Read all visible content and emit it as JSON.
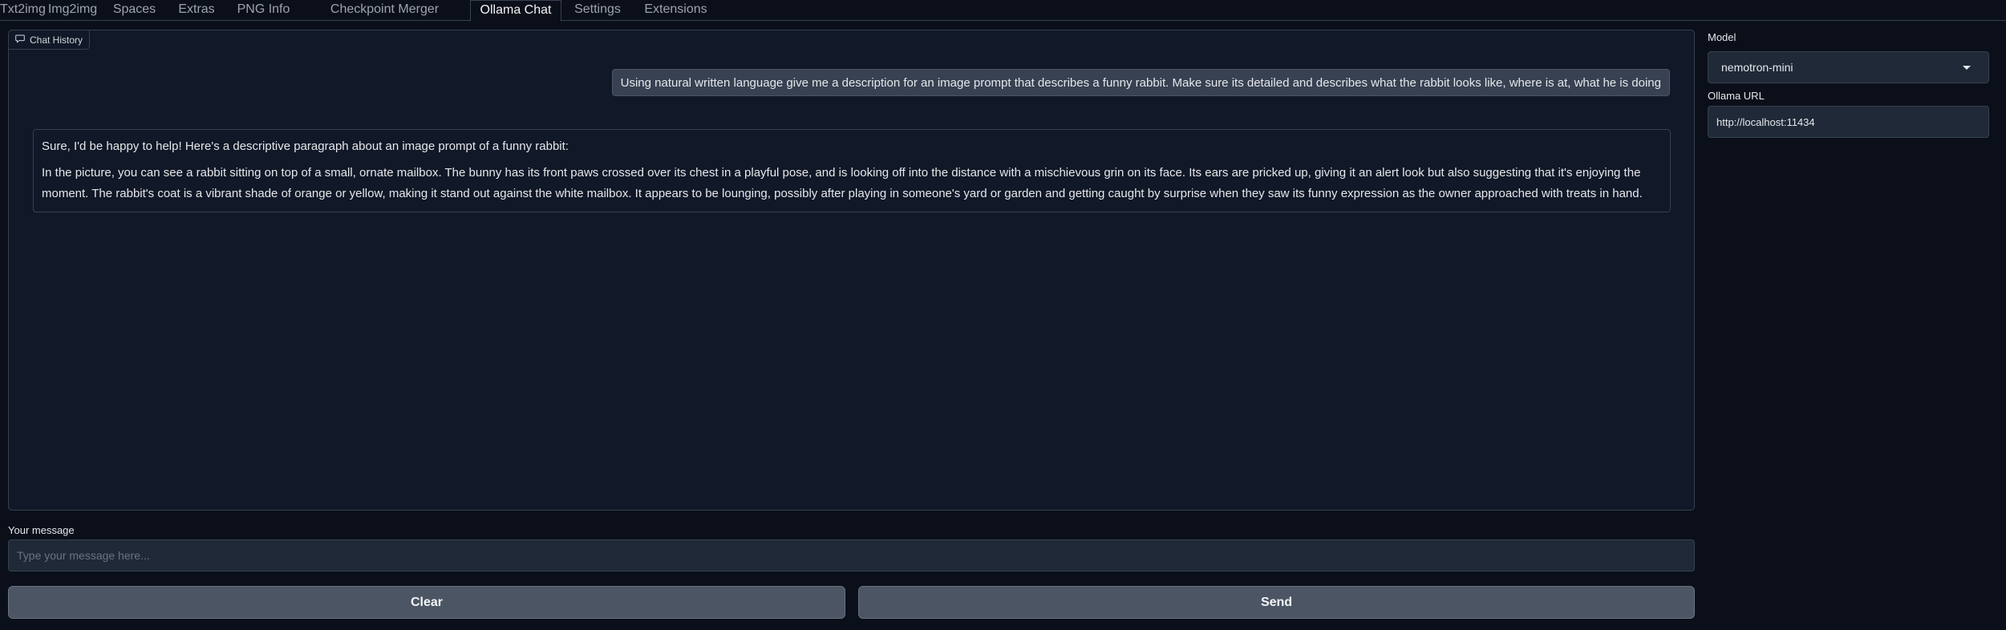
{
  "tabs": [
    {
      "label": "Txt2img"
    },
    {
      "label": "Img2img"
    },
    {
      "label": "Spaces"
    },
    {
      "label": "Extras"
    },
    {
      "label": "PNG Info"
    },
    {
      "label": "Checkpoint Merger"
    },
    {
      "label": "Ollama Chat",
      "active": true
    },
    {
      "label": "Settings"
    },
    {
      "label": "Extensions"
    }
  ],
  "chat": {
    "label": "Chat History",
    "icon": "chat-icon",
    "user_message": "Using natural written language give me a description for an image prompt that describes a funny rabbit. Make sure its detailed and describes what the rabbit looks like, where is at, what he is doing",
    "bot_intro": "Sure, I'd be happy to help! Here's a descriptive paragraph about an image prompt of a funny rabbit:",
    "bot_body": "In the picture, you can see a rabbit sitting on top of a small, ornate mailbox. The bunny has its front paws crossed over its chest in a playful pose, and is looking off into the distance with a mischievous grin on its face. Its ears are pricked up, giving it an alert look but also suggesting that it's enjoying the moment. The rabbit's coat is a vibrant shade of orange or yellow, making it stand out against the white mailbox. It appears to be lounging, possibly after playing in someone's yard or garden and getting caught by surprise when they saw its funny expression as the owner approached with treats in hand."
  },
  "message": {
    "label": "Your message",
    "value": "",
    "placeholder": "Type your message here..."
  },
  "buttons": {
    "clear": "Clear",
    "send": "Send"
  },
  "settings": {
    "model_label": "Model",
    "model_value": "nemotron-mini",
    "url_label": "Ollama URL",
    "url_value": "http://localhost:11434"
  },
  "colors": {
    "background": "#0b0f19",
    "panel": "#111827",
    "input": "#1f2937",
    "border": "#374151",
    "button": "#4b5563"
  }
}
